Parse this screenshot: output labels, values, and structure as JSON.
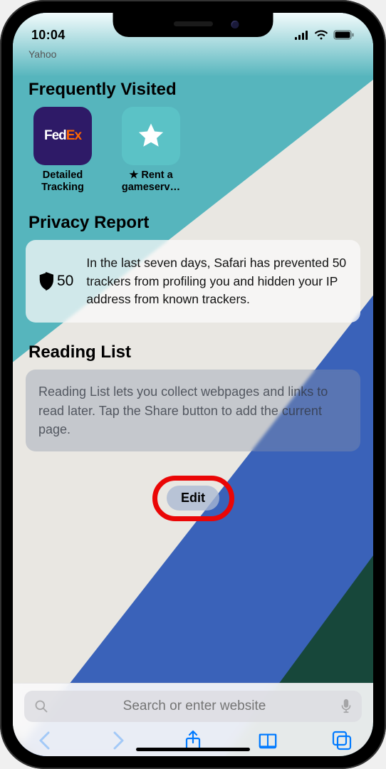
{
  "status": {
    "time": "10:04"
  },
  "ghost_header": "Yahoo",
  "sections": {
    "frequently_visited": {
      "title": "Frequently Visited",
      "items": [
        {
          "icon": "fedex",
          "caption": "Detailed\nTracking"
        },
        {
          "icon": "star",
          "caption": "★ Rent a\ngameserv…"
        }
      ]
    },
    "privacy_report": {
      "title": "Privacy Report",
      "tracker_count": "50",
      "text": "In the last seven days, Safari has prevented 50 trackers from profiling you and hidden your IP address from known trackers."
    },
    "reading_list": {
      "title": "Reading List",
      "text": "Reading List lets you collect webpages and links to read later. Tap the Share button to add the current page."
    }
  },
  "edit_button": "Edit",
  "search": {
    "placeholder": "Search or enter website"
  }
}
